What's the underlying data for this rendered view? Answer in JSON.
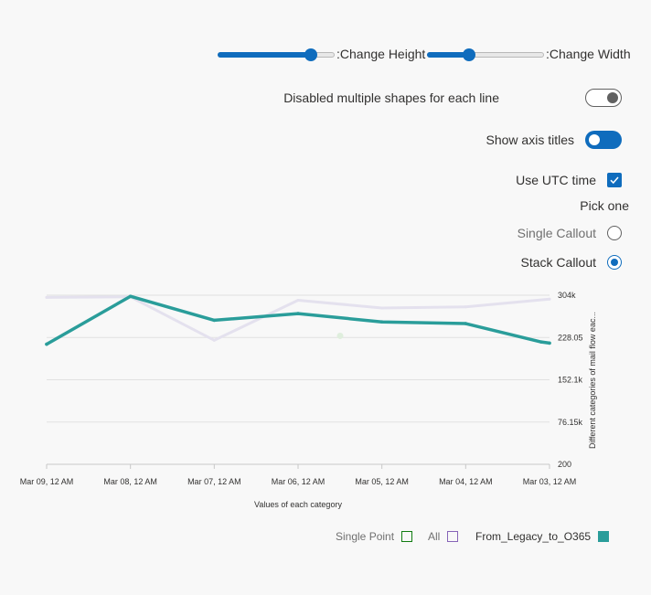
{
  "controls": {
    "height_slider": {
      "label": ":Change Height",
      "value": 0.8
    },
    "width_slider": {
      "label": ":Change Width",
      "value": 0.36
    },
    "multiple_shapes": {
      "label": "Disabled multiple shapes for each line",
      "checked": false
    },
    "axis_titles": {
      "label": "Show axis titles",
      "checked": true
    },
    "utc_time": {
      "label": "Use UTC time",
      "checked": true
    },
    "callout": {
      "title": "Pick one",
      "options": [
        {
          "label": "Single Callout",
          "selected": false
        },
        {
          "label": "Stack Callout",
          "selected": true
        }
      ]
    }
  },
  "colors": {
    "accent": "#0f6cbd",
    "series_main": "#2a9d9a",
    "series_faint": "#e4e1ee",
    "single_point": "#107c10",
    "all": "#8764b8"
  },
  "chart_data": {
    "type": "line",
    "x": [
      "Mar 09, 12 AM",
      "Mar 08, 12 AM",
      "Mar 07, 12 AM",
      "Mar 06, 12 AM",
      "Mar 05, 12 AM",
      "Mar 04, 12 AM",
      "Mar 03, 12 AM"
    ],
    "x_tick_labels": [
      "Mar 09, 12 AM",
      "Mar 08, 12 AM",
      "Mar 07, 12 AM",
      "Mar 06, 12 AM",
      "Mar 05, 12 AM",
      "Mar 04, 12 AM",
      "Mar 03, 12 AM"
    ],
    "y_tick_labels": [
      "304k",
      "228.05",
      "152.1k",
      "76.15k",
      "200"
    ],
    "ylim": [
      200,
      304000
    ],
    "y_axis_position": "right",
    "xlabel": "Values of each category",
    "ylabel": "Different categories of mail flow eac...",
    "grid": true,
    "series": [
      {
        "name": "From_Legacy_to_O365",
        "color": "#2a9d9a",
        "points": [
          {
            "x": "Mar 09, 12 AM",
            "y": 216000
          },
          {
            "x": "Mar 08, 12 AM",
            "y": 302000
          },
          {
            "x": "Mar 07, 12 AM",
            "y": 259000
          },
          {
            "x": "Mar 06, 12 AM",
            "y": 271000
          },
          {
            "x": "Mar 05, 12 AM",
            "y": 256000
          },
          {
            "x": "Mar 04, 12 AM",
            "y": 253000
          },
          {
            "x": "Mar 03, 12 AM",
            "y": 220000
          },
          {
            "x": "Mar 03, 12 AM",
            "y": 218000
          }
        ]
      },
      {
        "name": "",
        "color": "#e4e1ee",
        "points": [
          {
            "x": "Mar 09, 12 AM",
            "y": 300000
          },
          {
            "x": "Mar 08, 12 AM",
            "y": 301000
          },
          {
            "x": "Mar 07, 12 AM",
            "y": 223000
          },
          {
            "x": "Mar 06, 12 AM",
            "y": 295000
          },
          {
            "x": "Mar 05, 12 AM",
            "y": 281000
          },
          {
            "x": "Mar 04, 12 AM",
            "y": 283000
          },
          {
            "x": "Mar 03, 12 AM",
            "y": 297000
          }
        ]
      },
      {
        "name": "Single Point",
        "color": "#dfeedd",
        "points": [
          {
            "x": "Mar 06, 12 AM",
            "y": 231000
          }
        ]
      }
    ],
    "legend": [
      {
        "label": "Single Point",
        "color": "#107c10",
        "filled": false
      },
      {
        "label": "All",
        "color": "#8764b8",
        "filled": false
      },
      {
        "label": "From_Legacy_to_O365",
        "color": "#2a9d9a",
        "filled": true
      }
    ],
    "legend_position": "bottom-right"
  }
}
